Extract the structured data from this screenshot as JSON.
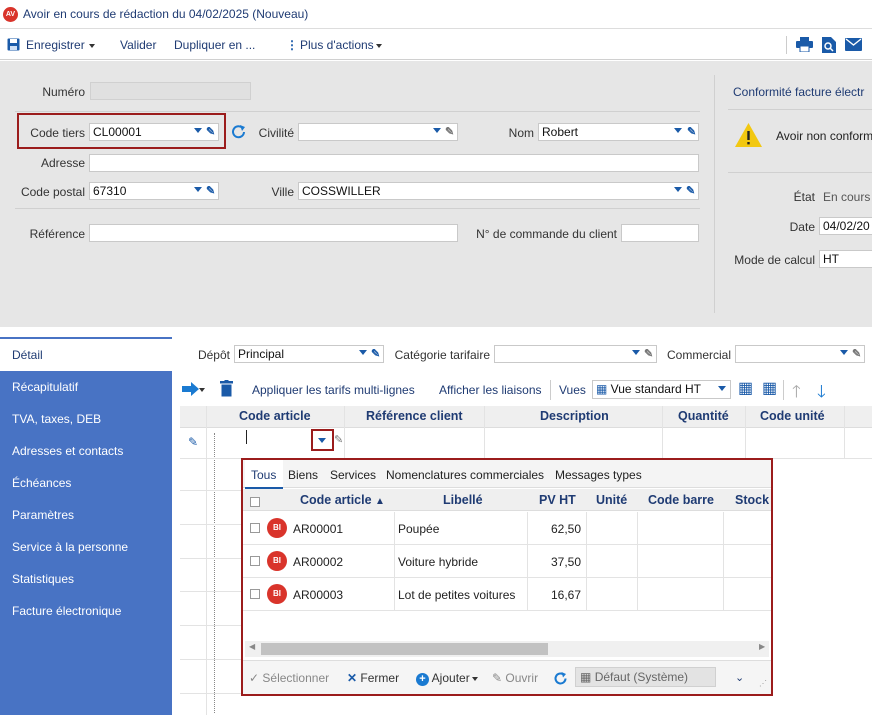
{
  "window": {
    "app_icon": "AV",
    "title": "Avoir en cours de rédaction du 04/02/2025 (Nouveau)"
  },
  "toolbar": {
    "save": "Enregistrer",
    "validate": "Valider",
    "duplicate": "Dupliquer en ...",
    "more": "Plus d'actions",
    "icons": [
      "printer-icon",
      "preview-icon",
      "email-icon"
    ]
  },
  "form": {
    "numero": {
      "label": "Numéro",
      "value": ""
    },
    "code_tiers": {
      "label": "Code tiers",
      "value": "CL00001"
    },
    "civilite": {
      "label": "Civilité",
      "value": ""
    },
    "nom": {
      "label": "Nom",
      "value": "Robert"
    },
    "adresse": {
      "label": "Adresse",
      "value": ""
    },
    "code_postal": {
      "label": "Code postal",
      "value": "67310"
    },
    "ville": {
      "label": "Ville",
      "value": "COSSWILLER"
    },
    "reference": {
      "label": "Référence",
      "value": ""
    },
    "num_commande": {
      "label": "N° de commande du client",
      "value": ""
    }
  },
  "right_panel": {
    "link": "Conformité facture électr",
    "warning": "Avoir non conform",
    "etat": {
      "label": "État",
      "value": "En cours"
    },
    "date": {
      "label": "Date",
      "value": "04/02/20"
    },
    "mode_calcul": {
      "label": "Mode de calcul",
      "value": "HT"
    }
  },
  "sidebar": {
    "items": [
      {
        "label": "Détail",
        "active": true
      },
      {
        "label": "Récapitulatif"
      },
      {
        "label": "TVA, taxes, DEB"
      },
      {
        "label": "Adresses et contacts"
      },
      {
        "label": "Échéances"
      },
      {
        "label": "Paramètres"
      },
      {
        "label": "Service à la personne"
      },
      {
        "label": "Statistiques"
      },
      {
        "label": "Facture électronique"
      }
    ]
  },
  "details": {
    "depot": {
      "label": "Dépôt",
      "value": "Principal"
    },
    "categorie": {
      "label": "Catégorie tarifaire",
      "value": ""
    },
    "commercial": {
      "label": "Commercial",
      "value": ""
    },
    "apply_tariffs": "Appliquer les tarifs multi-lignes",
    "show_links": "Afficher les liaisons",
    "views_label": "Vues",
    "view_value": "Vue standard HT",
    "columns": [
      "Code article",
      "Référence client",
      "Description",
      "Quantité",
      "Code unité"
    ]
  },
  "popup": {
    "tabs": [
      "Tous",
      "Biens",
      "Services",
      "Nomenclatures commerciales",
      "Messages types"
    ],
    "columns": [
      "Code article",
      "Libellé",
      "PV HT",
      "Unité",
      "Code barre",
      "Stock"
    ],
    "rows": [
      {
        "badge": "BI",
        "code": "AR00001",
        "libelle": "Poupée",
        "pv": "62,50"
      },
      {
        "badge": "BI",
        "code": "AR00002",
        "libelle": "Voiture hybride",
        "pv": "37,50"
      },
      {
        "badge": "BI",
        "code": "AR00003",
        "libelle": "Lot de petites voitures",
        "pv": "16,67"
      }
    ],
    "footer": {
      "select": "Sélectionner",
      "close": "Fermer",
      "add": "Ajouter",
      "open": "Ouvrir",
      "layout": "Défaut (Système)"
    }
  },
  "colors": {
    "accent": "#1f3b73",
    "sidebar": "#4873c4",
    "highlight": "#9b1c1c",
    "badge": "#d9342b"
  }
}
